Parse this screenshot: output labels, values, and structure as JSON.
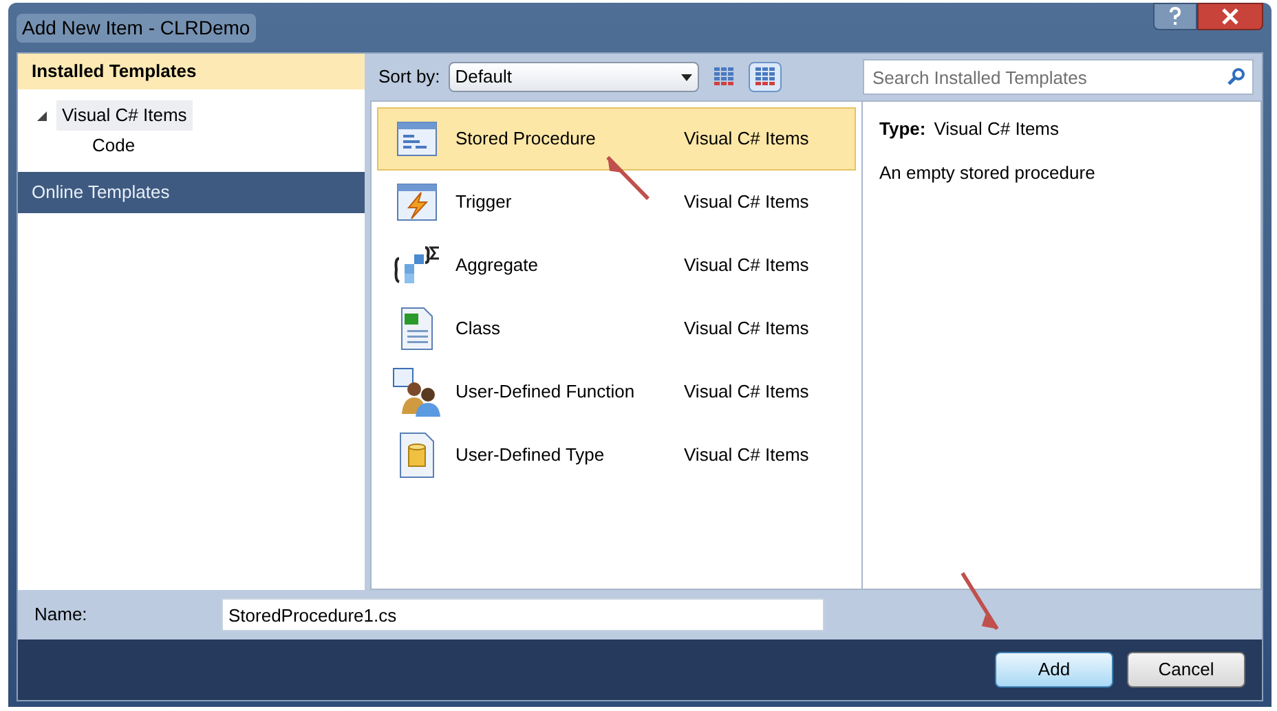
{
  "window": {
    "title": "Add New Item - CLRDemo"
  },
  "sidebar": {
    "header": "Installed Templates",
    "items": [
      {
        "label": "Visual C# Items",
        "expanded": true,
        "selected": true,
        "children": [
          {
            "label": "Code",
            "selected": false
          }
        ]
      }
    ],
    "online": "Online Templates"
  },
  "toolbar": {
    "sort_label": "Sort by:",
    "sort_value": "Default",
    "views": [
      {
        "selected": false
      },
      {
        "selected": true
      }
    ],
    "search": {
      "placeholder": "Search Installed Templates"
    }
  },
  "templates": [
    {
      "name": "Stored Procedure",
      "category": "Visual C# Items",
      "selected": true
    },
    {
      "name": "Trigger",
      "category": "Visual C# Items",
      "selected": false
    },
    {
      "name": "Aggregate",
      "category": "Visual C# Items",
      "selected": false
    },
    {
      "name": "Class",
      "category": "Visual C# Items",
      "selected": false
    },
    {
      "name": "User-Defined Function",
      "category": "Visual C# Items",
      "selected": false
    },
    {
      "name": "User-Defined Type",
      "category": "Visual C# Items",
      "selected": false
    }
  ],
  "details": {
    "type_label": "Type:",
    "type_value": "Visual C# Items",
    "description": "An empty stored procedure"
  },
  "name_field": {
    "label": "Name:",
    "value": "StoredProcedure1.cs"
  },
  "buttons": [
    {
      "label": "Add",
      "default": true
    },
    {
      "label": "Cancel",
      "default": false
    }
  ]
}
